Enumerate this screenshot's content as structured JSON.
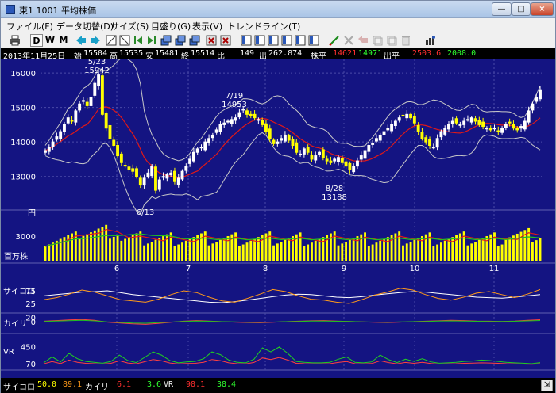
{
  "window": {
    "title": "東1 1001 平均株価",
    "minimize": "—",
    "maximize": "□",
    "close": "×"
  },
  "menu": [
    {
      "label": "ファイル(F)"
    },
    {
      "label": "データ切替(D)"
    },
    {
      "label": "サイズ(S)"
    },
    {
      "label": "目盛り(G)"
    },
    {
      "label": "表示(V)"
    },
    {
      "label": "トレンドライン(T)"
    }
  ],
  "toolbar": {
    "d_label": "D",
    "w_label": "W",
    "m_label": "M"
  },
  "quote": {
    "date": "2013年11月25日",
    "open_label": "始",
    "open": "15504",
    "high_label": "高",
    "high": "15535",
    "low_label": "安",
    "low": "15481",
    "close_label": "終",
    "close": "15514",
    "change_label": "比",
    "change": "149",
    "volume_label": "出",
    "volume": "262.874",
    "ma_label": "株平",
    "ma1": "14621",
    "ma2": "14971",
    "vol_ma_label": "出平",
    "vol_ma1": "2503.6",
    "vol_ma2": "2008.0"
  },
  "colors": {
    "background": "#141482",
    "candle_up": "#ffffff",
    "candle_down": "#ffff00",
    "ma_short": "#e01818",
    "band": "#c8c8c8",
    "volume": "#ffff00",
    "vol_ma_short": "#e01818",
    "vol_ma_long": "#20c020",
    "psy": "#ffffff",
    "psy2": "#ff9a1a",
    "kairi": "#ff4040",
    "kairi2": "#20c020",
    "vr": "#20d020"
  },
  "chart_data": {
    "type": "candlestick",
    "price_axis": {
      "ticks": [
        13000,
        14000,
        15000,
        16000
      ],
      "ylim": [
        12350,
        16300
      ],
      "unit_label": "円"
    },
    "x_ticks": [
      "6",
      "7",
      "8",
      "9",
      "10",
      "11"
    ],
    "annotations": [
      {
        "date": "5/23",
        "value": "15942"
      },
      {
        "date": "6/13",
        "value": ""
      },
      {
        "date": "7/19",
        "value": "14953"
      },
      {
        "date": "8/28",
        "value": "13188"
      }
    ],
    "volume_axis": {
      "ticks": [
        3000
      ],
      "unit_label": "百万株",
      "max": 4800
    },
    "psy": {
      "label": "サイコロ",
      "ticks": [
        75,
        25
      ],
      "ylim": [
        0,
        100
      ]
    },
    "kairi": {
      "label": "カイリ",
      "ticks": [
        20,
        0
      ],
      "ylim": [
        -25,
        25
      ]
    },
    "vr": {
      "label": "VR",
      "ticks": [
        450,
        70
      ],
      "ylim": [
        0,
        560
      ]
    },
    "closes": [
      13750,
      13850,
      14000,
      14150,
      14300,
      14500,
      14700,
      14600,
      14900,
      15100,
      15200,
      15050,
      15300,
      15700,
      15942,
      14800,
      14400,
      14100,
      13900,
      13600,
      13400,
      13300,
      13200,
      13150,
      13000,
      12750,
      12950,
      13100,
      13300,
      12600,
      12900,
      13000,
      13050,
      13100,
      12850,
      12950,
      13150,
      13300,
      13500,
      13700,
      13800,
      13850,
      14000,
      14100,
      14200,
      14350,
      14500,
      14550,
      14600,
      14650,
      14700,
      14850,
      14953,
      14800,
      14750,
      14700,
      14650,
      14500,
      14300,
      14100,
      13950,
      14000,
      14100,
      14200,
      14050,
      13900,
      13700,
      13650,
      13800,
      13700,
      13500,
      13600,
      13700,
      13550,
      13450,
      13400,
      13500,
      13550,
      13400,
      13300,
      13188,
      13300,
      13450,
      13600,
      13750,
      13900,
      13950,
      14100,
      14200,
      14300,
      14400,
      14500,
      14600,
      14700,
      14750,
      14800,
      14700,
      14550,
      14300,
      14100,
      14000,
      13900,
      13850,
      14100,
      14300,
      14400,
      14500,
      14600,
      14550,
      14500,
      14600,
      14650,
      14700,
      14600,
      14500,
      14450,
      14400,
      14350,
      14400,
      14300,
      14400,
      14500,
      14550,
      14400,
      14350,
      14450,
      14600,
      14900,
      15100,
      15300,
      15514
    ],
    "psy_values": [
      55,
      60,
      65,
      70,
      72,
      75,
      68,
      60,
      55,
      50,
      45,
      40,
      35,
      30,
      28,
      32,
      38,
      45,
      52,
      58,
      62,
      60,
      55,
      50,
      48,
      52,
      58,
      63,
      68,
      72,
      70,
      65,
      60,
      55,
      50,
      48,
      46,
      50,
      55,
      60
    ],
    "psy2_values": [
      40,
      48,
      62,
      78,
      70,
      55,
      40,
      35,
      30,
      42,
      60,
      75,
      68,
      50,
      35,
      30,
      45,
      62,
      80,
      72,
      55,
      42,
      38,
      30,
      25,
      40,
      58,
      70,
      85,
      78,
      60,
      45,
      38,
      50,
      66,
      72,
      60,
      48,
      62,
      80
    ],
    "kairi_values": [
      2,
      5,
      8,
      10,
      6,
      -2,
      -6,
      -10,
      -12,
      -8,
      -3,
      2,
      5,
      3,
      0,
      -2,
      -4,
      -5,
      -3,
      0,
      2,
      4,
      5,
      3,
      1,
      -1,
      -3,
      -4,
      -2,
      0,
      2,
      4,
      6,
      5,
      3,
      2,
      1,
      3,
      6,
      9
    ],
    "vr_values": [
      90,
      220,
      110,
      300,
      180,
      120,
      100,
      80,
      120,
      260,
      140,
      95,
      210,
      330,
      260,
      140,
      90,
      110,
      120,
      180,
      330,
      270,
      150,
      100,
      90,
      170,
      420,
      330,
      440,
      300,
      120,
      100,
      90,
      90,
      100,
      170,
      220,
      100,
      90,
      110,
      260,
      160,
      95,
      170,
      120,
      180,
      110,
      80,
      90,
      100,
      120,
      130,
      150,
      140,
      120,
      100,
      90,
      80,
      70,
      95
    ]
  },
  "bottom": {
    "psy_label": "サイコロ",
    "psy1": "50.0",
    "psy2": "89.1",
    "kairi_label": "カイリ",
    "kairi1": "6.1",
    "kairi2": "3.6",
    "vr_label": "VR",
    "vr1": "98.1",
    "vr2": "38.4",
    "resize": "⇲"
  }
}
